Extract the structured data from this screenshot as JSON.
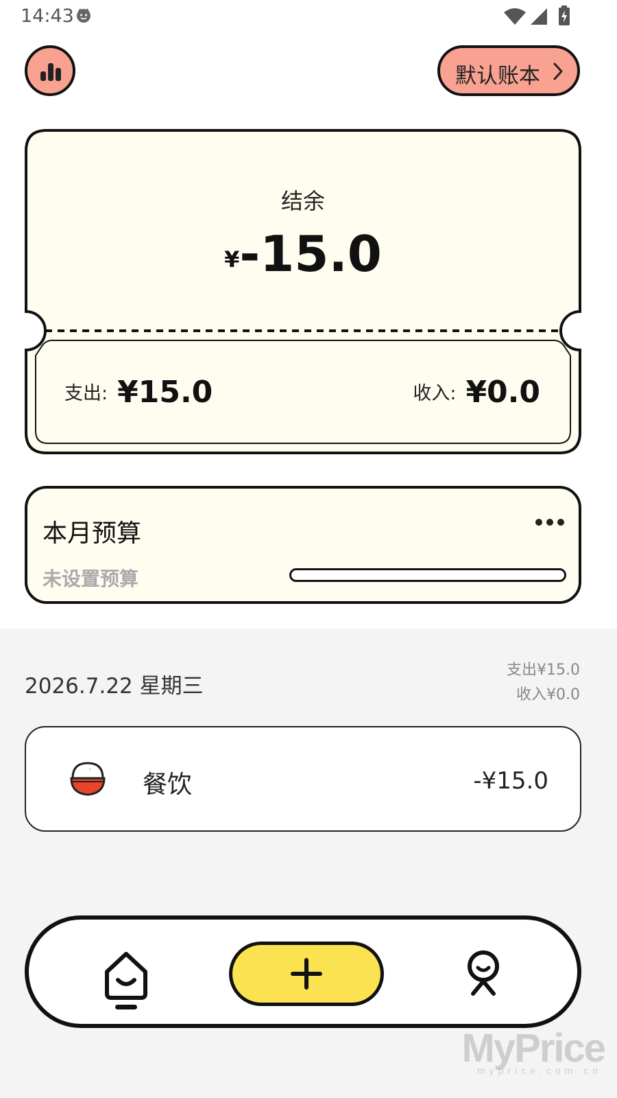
{
  "status_bar": {
    "time": "14:43",
    "icons": [
      "notification-face-icon",
      "wifi-icon",
      "signal-icon",
      "battery-charging-icon"
    ]
  },
  "header": {
    "stats_icon": "bar-chart-icon",
    "ledger_label": "默认账本",
    "ledger_icon": "chevron-right-icon"
  },
  "balance_card": {
    "title": "结余",
    "currency_symbol": "¥",
    "amount": "-15.0",
    "expense_label": "支出:",
    "expense_value": "¥15.0",
    "income_label": "收入:",
    "income_value": "¥0.0"
  },
  "budget": {
    "title": "本月预算",
    "status": "未设置预算",
    "more_icon": "more-dots-icon",
    "progress_percent": 0
  },
  "day_group": {
    "date": "2026.7.22 星期三",
    "expense_summary": "支出¥15.0",
    "income_summary": "收入¥0.0",
    "records": [
      {
        "icon": "rice-bowl-icon",
        "category": "餐饮",
        "amount": "-¥15.0"
      }
    ]
  },
  "bottom_nav": {
    "home_icon": "home-icon",
    "add_icon": "plus-icon",
    "profile_icon": "profile-icon"
  },
  "colors": {
    "accent_pink": "#f9a291",
    "accent_yellow": "#fbe251",
    "card_cream": "#fffcf0",
    "rice_bowl_red": "#e8452c"
  },
  "watermark": {
    "text": "MyPrice",
    "sub": "myprice.com.cn"
  }
}
